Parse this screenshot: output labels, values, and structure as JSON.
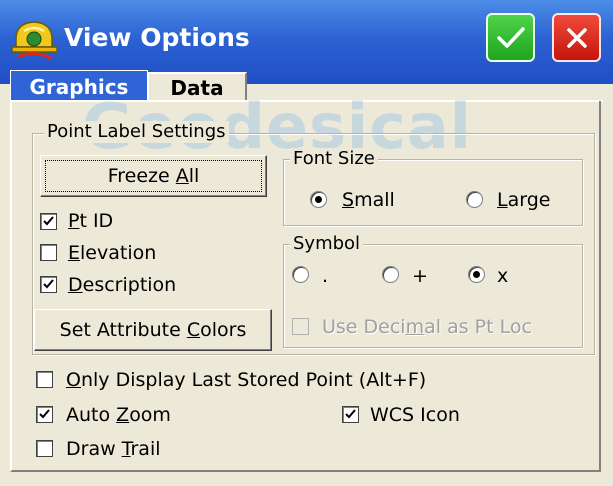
{
  "window": {
    "title": "View Options",
    "ok_icon": "checkmark-icon",
    "close_icon": "close-x-icon",
    "app_icon": "hardhat-logo-icon"
  },
  "tabs": [
    {
      "label": "Graphics",
      "active": true
    },
    {
      "label": "Data",
      "active": false
    }
  ],
  "watermark": "Geodesical",
  "point_label_settings": {
    "title": "Point Label Settings",
    "freeze_all": {
      "pre": "Freeze ",
      "u": "A",
      "post": "ll"
    },
    "pt_id": {
      "pre": "",
      "u": "P",
      "post": "t ID",
      "checked": true
    },
    "elevation": {
      "pre": "",
      "u": "E",
      "post": "levation",
      "checked": false
    },
    "description": {
      "pre": "",
      "u": "D",
      "post": "escription",
      "checked": true
    },
    "set_attribute_colors": {
      "pre": "Set Attribute ",
      "u": "C",
      "post": "olors"
    }
  },
  "font_size": {
    "title": "Font Size",
    "small": {
      "pre": "",
      "u": "S",
      "post": "mall",
      "selected": true
    },
    "large": {
      "pre": "",
      "u": "L",
      "post": "arge",
      "selected": false
    }
  },
  "symbol": {
    "title": "Symbol",
    "options": [
      {
        "label": ".",
        "selected": false
      },
      {
        "label": "+",
        "selected": false
      },
      {
        "label": "x",
        "selected": true
      }
    ],
    "use_decimal": {
      "pre": "Use Deci",
      "u": "m",
      "post": "al as Pt Loc",
      "checked": false,
      "enabled": false
    }
  },
  "only_display_last": {
    "pre": "",
    "u": "O",
    "post": "nly Display Last Stored Point (Alt+F)",
    "checked": false
  },
  "auto_zoom": {
    "pre": "Auto ",
    "u": "Z",
    "post": "oom",
    "checked": true
  },
  "wcs_icon": {
    "label": "WCS Icon",
    "checked": true
  },
  "draw_trail": {
    "pre": "Draw ",
    "u": "T",
    "post": "rail",
    "checked": false
  },
  "colors": {
    "titlebar": "#2d62d3",
    "ok_green": "#1fa61e",
    "close_red": "#c5160c",
    "active_tab": "#2f63d6",
    "background": "#ece9d8"
  }
}
